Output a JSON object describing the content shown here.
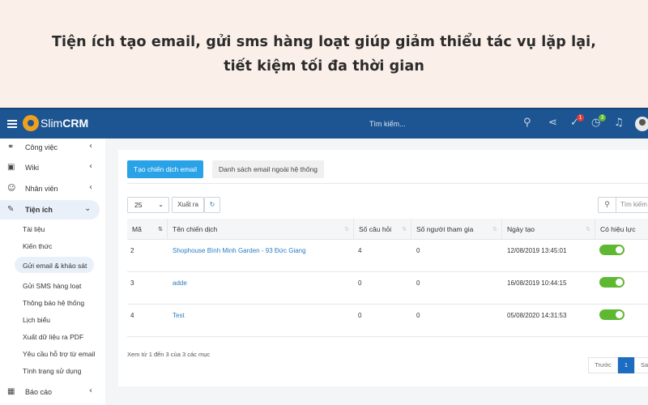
{
  "banner": {
    "line1": "Tiện ích tạo email, gửi sms hàng loạt giúp giảm thiểu tác vụ lặp lại,",
    "line2": "tiết kiệm tối đa thời gian"
  },
  "topbar": {
    "logo_prefix": "Slim",
    "logo_bold": "CRM",
    "search_placeholder": "Tìm kiếm...",
    "task_badge": "1",
    "clock_badge": "3",
    "colors": {
      "bar": "#1c5591",
      "task_badge": "#e23b3b",
      "clock_badge": "#5fb832"
    }
  },
  "sidebar": {
    "items": [
      {
        "label": "Công việc",
        "icon": "handshake-icon"
      },
      {
        "label": "Wiki",
        "icon": "wiki-icon"
      },
      {
        "label": "Nhân viên",
        "icon": "users-icon"
      },
      {
        "label": "Tiện ích",
        "icon": "wrench-icon"
      }
    ],
    "sub_items": [
      "Tài liệu",
      "Kiến thức",
      "Gửi email & khảo sát",
      "Gửi SMS hàng loạt",
      "Thông báo hệ thống",
      "Lịch biểu",
      "Xuất dữ liệu ra PDF",
      "Yêu cầu hỗ trợ từ email",
      "Tình trạng sử dụng"
    ],
    "bottom_item": {
      "label": "Báo cáo",
      "icon": "chart-icon"
    }
  },
  "main": {
    "tab_active": "Tạo chiến dịch email",
    "tab_other": "Danh sách email ngoài hệ thống",
    "page_size": "25",
    "export_label": "Xuất ra",
    "search_placeholder": "Tìm kiếm",
    "columns": [
      "Mã",
      "Tên chiến dịch",
      "Số câu hỏi",
      "Số người tham gia",
      "Ngày tạo",
      "Có hiệu lực"
    ],
    "rows": [
      {
        "id": "2",
        "name": "Shophouse Bình Minh Garden - 93 Đức Giang",
        "questions": "4",
        "participants": "0",
        "created": "12/08/2019 13:45:01",
        "active": true
      },
      {
        "id": "3",
        "name": "adde",
        "questions": "0",
        "participants": "0",
        "created": "16/08/2019 10:44:15",
        "active": true
      },
      {
        "id": "4",
        "name": "Test",
        "questions": "0",
        "participants": "0",
        "created": "05/08/2020 14:31:53",
        "active": true
      }
    ],
    "info": "Xem từ 1 đến 3 của 3 các mục",
    "pager": {
      "prev": "Trước",
      "current": "1",
      "next": "Sau"
    },
    "colors": {
      "primary_button": "#2aa2e8",
      "toggle_on": "#5fb832",
      "link": "#2a7ec2"
    }
  }
}
